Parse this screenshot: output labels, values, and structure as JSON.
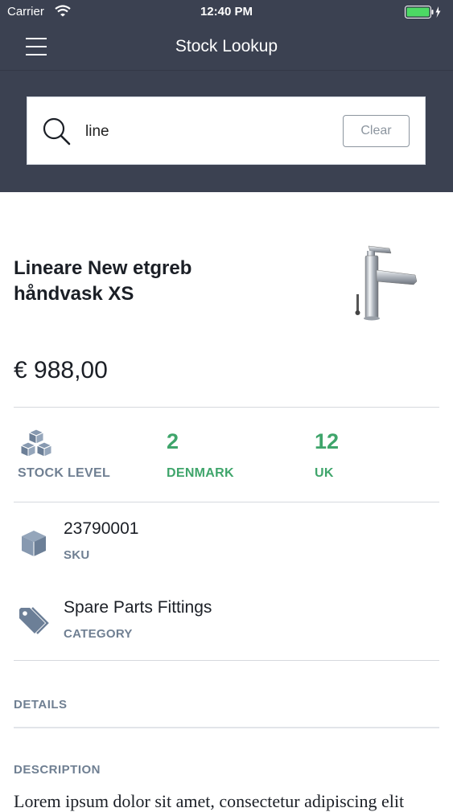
{
  "status_bar": {
    "carrier": "Carrier",
    "time": "12:40 PM",
    "battery_color": "#4cd964"
  },
  "nav": {
    "title": "Stock Lookup",
    "menu_icon": "hamburger-menu-icon"
  },
  "search": {
    "value": "line",
    "clear_label": "Clear",
    "icon": "search-icon"
  },
  "product": {
    "name_line1": "Lineare New etgreb",
    "name_line2": "håndvask XS",
    "image_icon": "faucet-image",
    "price": "€ 988,00"
  },
  "stock": {
    "icon": "boxes-icon",
    "label": "STOCK LEVEL",
    "locations": [
      {
        "name": "DENMARK",
        "count": "2"
      },
      {
        "name": "UK",
        "count": "12"
      }
    ]
  },
  "sku": {
    "icon": "box-icon",
    "value": "23790001",
    "label": "SKU"
  },
  "category": {
    "icon": "tags-icon",
    "value": "Spare Parts Fittings",
    "label": "CATEGORY"
  },
  "sections": {
    "details": "DETAILS",
    "description": "DESCRIPTION"
  },
  "description_text": "Lorem ipsum dolor sit amet, consectetur adipiscing elit",
  "colors": {
    "header_bg": "#3b4151",
    "accent_green": "#3fa56b",
    "label_gray": "#6f7f92"
  }
}
